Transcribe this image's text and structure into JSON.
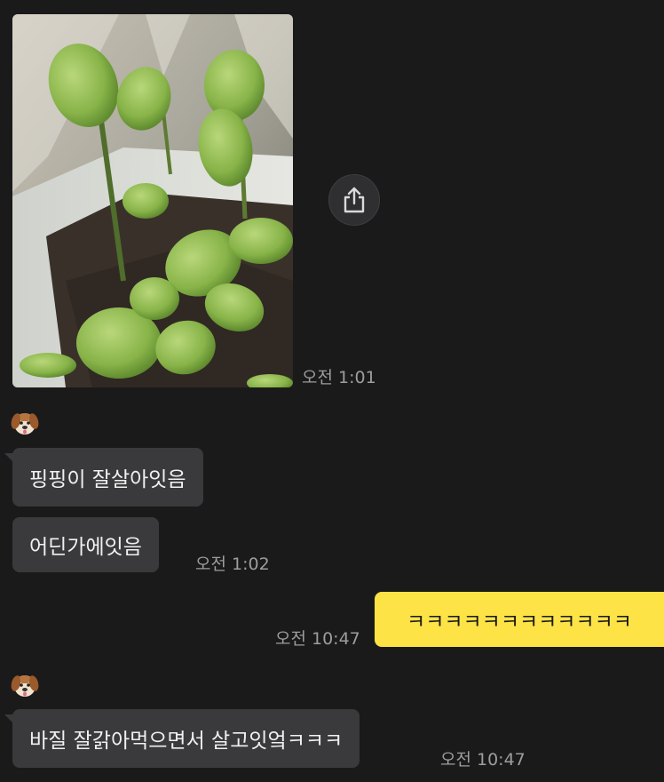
{
  "colors": {
    "background": "#1a1a1b",
    "friend_bubble": "#3a3a3c",
    "my_bubble": "#fde345",
    "timestamp": "#9d9d9f"
  },
  "messages": {
    "photo": {
      "time": "오전 1:01",
      "share_icon": "share-icon"
    },
    "group1": {
      "avatar_icon": "puppy-face-icon",
      "bubbles": [
        "핑핑이 잘살아잇음",
        "어딘가에잇음"
      ],
      "time": "오전 1:02"
    },
    "mine": {
      "text": "ㅋㅋㅋㅋㅋㅋㅋㅋㅋㅋㅋㅋ",
      "time": "오전 10:47"
    },
    "group2": {
      "avatar_icon": "puppy-face-icon",
      "bubbles": [
        "바질 잘갉아먹으면서 살고잇엌ㅋㅋㅋ"
      ],
      "time": "오전 10:47"
    }
  }
}
